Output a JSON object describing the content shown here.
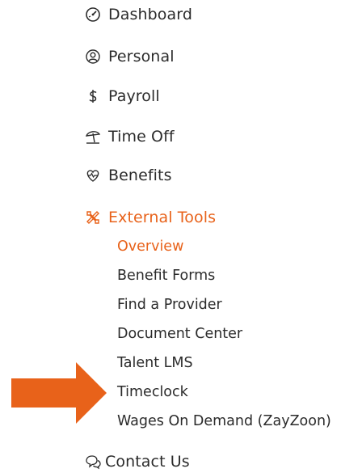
{
  "nav": {
    "items": [
      {
        "label": "Dashboard",
        "icon": "dashboard-gauge-icon"
      },
      {
        "label": "Personal",
        "icon": "user-circle-icon"
      },
      {
        "label": "Payroll",
        "icon": "dollar-icon"
      },
      {
        "label": "Time Off",
        "icon": "beach-umbrella-icon"
      },
      {
        "label": "Benefits",
        "icon": "heartbeat-icon"
      },
      {
        "label": "External Tools",
        "icon": "tools-icon",
        "active": true
      },
      {
        "label": "Contact Us",
        "icon": "chat-bubbles-icon"
      }
    ],
    "external_tools_sub": [
      {
        "label": "Overview",
        "active": true
      },
      {
        "label": "Benefit Forms"
      },
      {
        "label": "Find a Provider"
      },
      {
        "label": "Document Center"
      },
      {
        "label": "Talent LMS"
      },
      {
        "label": "Timeclock"
      },
      {
        "label": "Wages On Demand (ZayZoon)"
      }
    ]
  },
  "colors": {
    "accent": "#e8621a",
    "text": "#2b2b2b",
    "arrow": "#e8621a"
  },
  "annotation": {
    "arrow_icon": "right-arrow-icon",
    "points_to": "Timeclock"
  }
}
